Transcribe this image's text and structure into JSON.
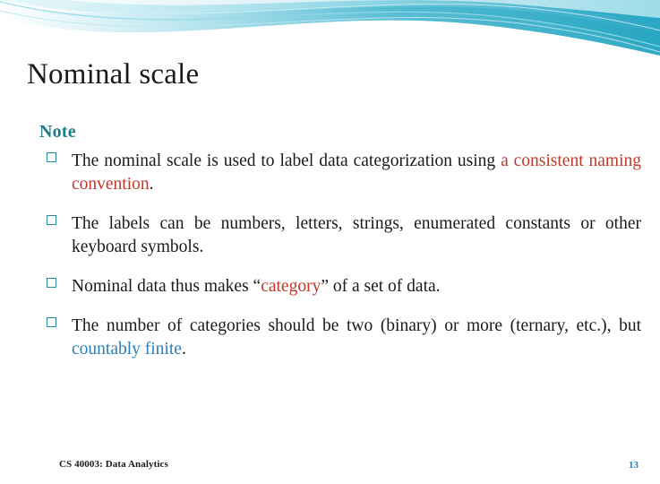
{
  "slide": {
    "title": "Nominal scale",
    "note_label": "Note",
    "bullets": [
      {
        "segments": [
          {
            "text": "The nominal scale is used to label data categorization using ",
            "style": "normal"
          },
          {
            "text": "a consistent naming convention",
            "style": "highlight-red"
          },
          {
            "text": ".",
            "style": "normal"
          }
        ]
      },
      {
        "segments": [
          {
            "text": "The labels can be numbers, letters, strings, enumerated constants or other keyboard symbols.",
            "style": "normal"
          }
        ]
      },
      {
        "segments": [
          {
            "text": "Nominal data thus makes “",
            "style": "normal"
          },
          {
            "text": "category",
            "style": "highlight-red"
          },
          {
            "text": "” of a set of data.",
            "style": "normal"
          }
        ]
      },
      {
        "segments": [
          {
            "text": "The number of categories should be two (binary) or more (ternary, etc.), but ",
            "style": "normal"
          },
          {
            "text": "countably finite",
            "style": "highlight-blue"
          },
          {
            "text": ".",
            "style": "normal"
          }
        ]
      }
    ],
    "footer": {
      "left": "CS 40003: Data Analytics",
      "page_number": "13"
    },
    "colors": {
      "accent_teal": "#1d7b8a",
      "bullet_outline": "#2a8a99",
      "highlight_red": "#c0392b",
      "highlight_blue": "#2a7fb8",
      "title_text": "#1a1a1a"
    },
    "banner": {
      "name": "decorative-swoosh-banner"
    }
  }
}
